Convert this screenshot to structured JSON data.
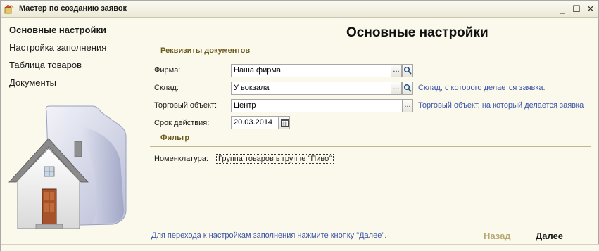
{
  "window": {
    "title": "Мастер по созданию заявок",
    "controls": {
      "minimize": "_",
      "maximize": "☐",
      "close": "✕"
    }
  },
  "sidebar": {
    "items": [
      {
        "label": "Основные настройки",
        "active": true
      },
      {
        "label": "Настройка заполнения",
        "active": false
      },
      {
        "label": "Таблица товаров",
        "active": false
      },
      {
        "label": "Документы",
        "active": false
      }
    ],
    "illustration": "folder-house-icon"
  },
  "main": {
    "title": "Основные настройки",
    "groups": {
      "requisites": "Реквизиты документов",
      "filter": "Фильтр"
    },
    "fields": {
      "firm": {
        "label": "Фирма:",
        "value": "Наша фирма"
      },
      "warehouse": {
        "label": "Склад:",
        "value": "У вокзала",
        "hint": "Склад, с которого делается заявка."
      },
      "trade_object": {
        "label": "Торговый объект:",
        "value": "Центр",
        "hint": "Торговый объект, на который делается заявка"
      },
      "valid_until": {
        "label": "Срок действия:",
        "value": "20.03.2014"
      },
      "nomenclature": {
        "label": "Номенклатура:",
        "value": "Группа товаров в группе \"Пиво\""
      }
    },
    "buttons": {
      "select": "...",
      "search_icon": "magnifier-icon",
      "calendar_icon": "calendar-icon"
    }
  },
  "footer": {
    "hint": "Для перехода к настройкам заполнения нажмите кнопку \"Далее\".",
    "back_label": "Назад",
    "next_label": "Далее"
  },
  "colors": {
    "background": "#fbf9ec",
    "group_title": "#6b5a1c",
    "hint_link": "#3b55a8",
    "disabled_button": "#b5a873"
  }
}
